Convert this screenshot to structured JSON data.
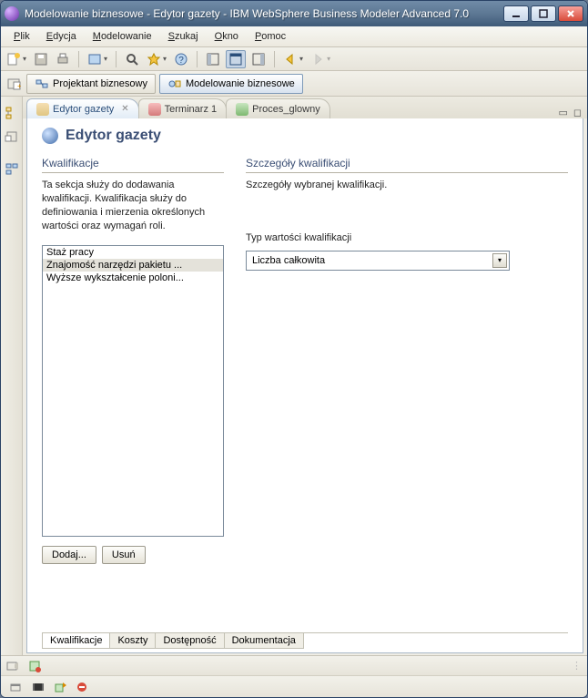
{
  "window": {
    "title": "Modelowanie biznesowe - Edytor gazety - IBM WebSphere Business Modeler Advanced 7.0"
  },
  "menu": {
    "plik": "Plik",
    "edycja": "Edycja",
    "modelowanie": "Modelowanie",
    "szukaj": "Szukaj",
    "okno": "Okno",
    "pomoc": "Pomoc"
  },
  "perspectives": {
    "design": "Projektant biznesowy",
    "model": "Modelowanie biznesowe"
  },
  "tabs": [
    {
      "label": "Edytor gazety"
    },
    {
      "label": "Terminarz 1"
    },
    {
      "label": "Proces_glowny"
    }
  ],
  "editor": {
    "title": "Edytor gazety",
    "left": {
      "heading": "Kwalifikacje",
      "desc": "Ta sekcja służy do dodawania kwalifikacji. Kwalifikacja służy do definiowania i mierzenia określonych wartości oraz wymagań roli.",
      "items": [
        "Staż pracy",
        "Znajomość narzędzi pakietu ...",
        "Wyższe wykształcenie poloni..."
      ],
      "add": "Dodaj...",
      "remove": "Usuń"
    },
    "right": {
      "heading": "Szczegóły kwalifikacji",
      "desc": "Szczegóły wybranej kwalifikacji.",
      "field_label": "Typ wartości kwalifikacji",
      "field_value": "Liczba całkowita"
    },
    "bottom_tabs": [
      "Kwalifikacje",
      "Koszty",
      "Dostępność",
      "Dokumentacja"
    ]
  }
}
